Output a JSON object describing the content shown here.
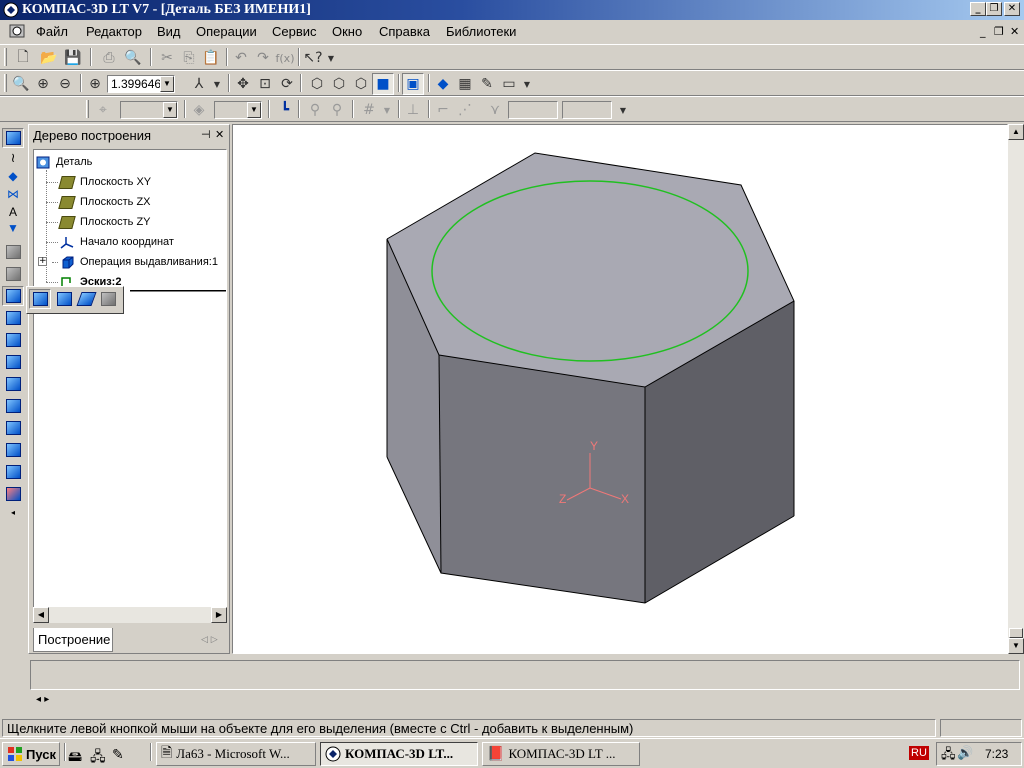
{
  "window": {
    "title": "КОМПАС-3D LT V7 - [Деталь БЕЗ ИМЕНИ1]",
    "min_glyph": "_",
    "restore_glyph": "❐",
    "close_glyph": "✕"
  },
  "menu": {
    "items": [
      "Файл",
      "Редактор",
      "Вид",
      "Операции",
      "Сервис",
      "Окно",
      "Справка",
      "Библиотеки"
    ]
  },
  "toolbar_view": {
    "zoom_value": "1.399646"
  },
  "tree": {
    "header": "Дерево построения",
    "pin_glyph": "⊣",
    "close_glyph": "✕",
    "root": "Деталь",
    "items": [
      "Плоскость XY",
      "Плоскость ZX",
      "Плоскость ZY",
      "Начало координат",
      "Операция выдавливания:1",
      "Эскиз:2"
    ],
    "tab_label": "Построение"
  },
  "viewport": {
    "axis_labels": {
      "y": "Y",
      "z": "Z",
      "x": "X"
    },
    "colors": {
      "top_face": "#a9a9b3",
      "front_face": "#76767e",
      "right_face": "#5f5f66",
      "left_face": "#8f8f98",
      "sketch_circle": "#20c020",
      "axes": "#f07878"
    }
  },
  "status": {
    "message": "Щелкните левой кнопкой мыши на объекте для его выделения (вместе с Ctrl - добавить к выделенным)"
  },
  "taskbar": {
    "start_label": "Пуск",
    "buttons": [
      "Ла63 - Microsoft W...",
      "КОМПАС-3D LT...",
      "КОМПАС-3D LT ..."
    ],
    "lang": "RU",
    "clock": "7:23"
  }
}
